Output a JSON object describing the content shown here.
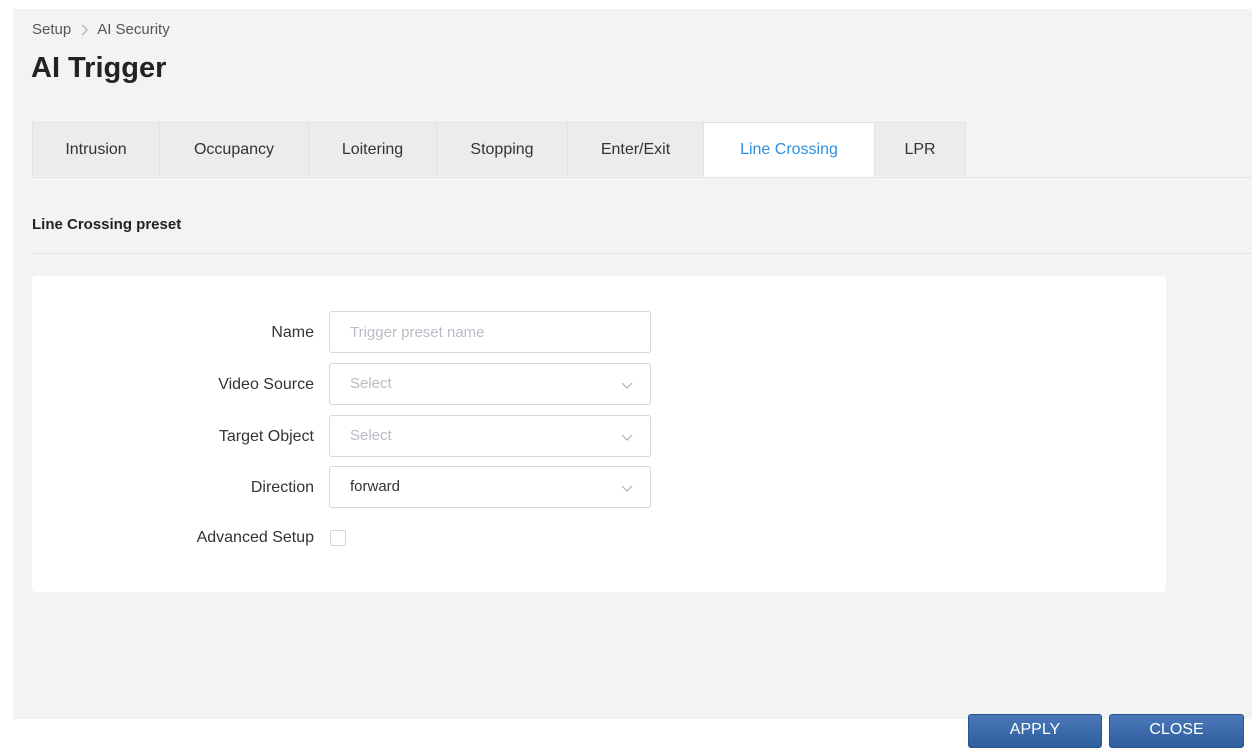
{
  "breadcrumb": {
    "root": "Setup",
    "current": "AI Security"
  },
  "page": {
    "title": "AI Trigger"
  },
  "tabs": [
    {
      "label": "Intrusion",
      "active": false
    },
    {
      "label": "Occupancy",
      "active": false
    },
    {
      "label": "Loitering",
      "active": false
    },
    {
      "label": "Stopping",
      "active": false
    },
    {
      "label": "Enter/Exit",
      "active": false
    },
    {
      "label": "Line Crossing",
      "active": true
    },
    {
      "label": "LPR",
      "active": false
    }
  ],
  "section": {
    "title": "Line Crossing preset"
  },
  "form": {
    "name": {
      "label": "Name",
      "value": "",
      "placeholder": "Trigger preset name"
    },
    "video_source": {
      "label": "Video Source",
      "value": "Select"
    },
    "target_object": {
      "label": "Target Object",
      "value": "Select"
    },
    "direction": {
      "label": "Direction",
      "value": "forward"
    },
    "advanced_setup": {
      "label": "Advanced Setup",
      "checked": false
    }
  },
  "actions": {
    "apply_label": "APPLY",
    "close_label": "CLOSE"
  },
  "icons": {
    "breadcrumb_separator": "chevron-right-icon",
    "select_arrow": "chevron-down-icon"
  },
  "colors": {
    "active_tab": "#2e8fe0",
    "button": "#3a69ab",
    "page_background": "#f3f3f3",
    "panel_background": "#ffffff"
  }
}
